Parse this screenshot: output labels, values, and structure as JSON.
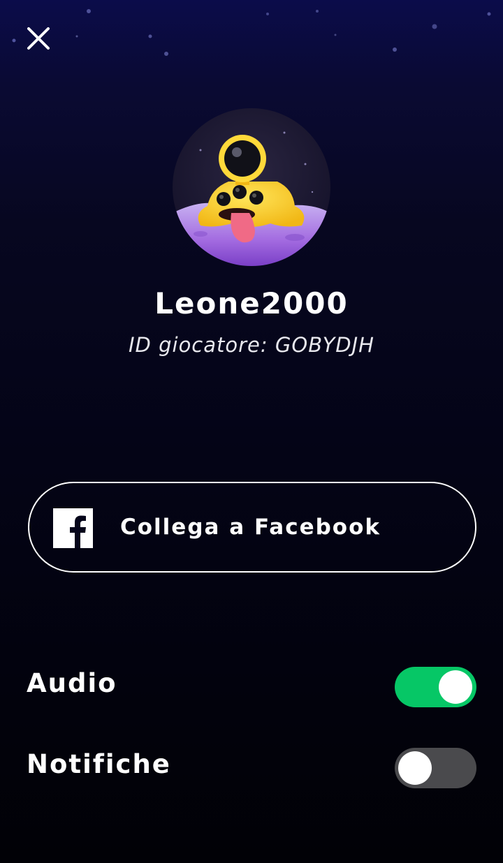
{
  "header": {
    "close_icon": "close-icon"
  },
  "profile": {
    "avatar_icon": "alien-avatar",
    "username": "Leone2000",
    "player_id": "ID giocatore: GOBYDJH"
  },
  "facebook": {
    "icon": "facebook-icon",
    "label": "Collega a Facebook"
  },
  "settings": {
    "audio": {
      "label": "Audio",
      "enabled": true
    },
    "notifications": {
      "label": "Notifiche",
      "enabled": false
    }
  },
  "colors": {
    "toggle_on": "#06c766",
    "toggle_off": "#4a4a4d",
    "text": "#ffffff"
  }
}
